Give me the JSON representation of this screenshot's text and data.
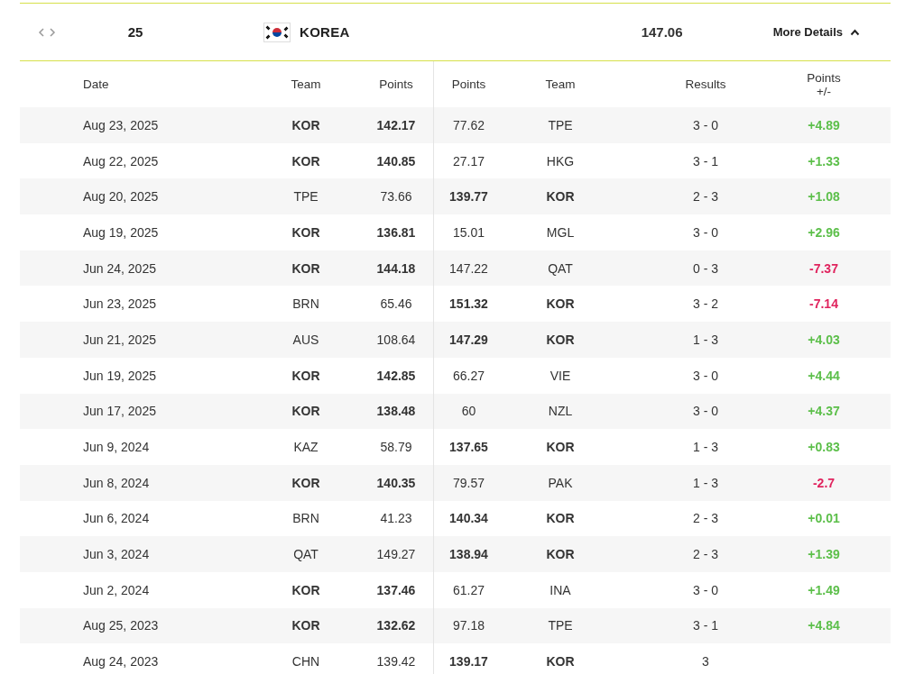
{
  "summary": {
    "rank": "25",
    "country": "KOREA",
    "points": "147.06",
    "toggle": {
      "label": "More Details",
      "expanded": true
    }
  },
  "table": {
    "columns": [
      "Date",
      "Team",
      "Points",
      "Points",
      "Team",
      "Results",
      "Points +/-"
    ],
    "rows": [
      {
        "date": "Aug 23, 2025",
        "left": {
          "team": "KOR",
          "points": "142.17",
          "highlighted": true
        },
        "right": {
          "team": "TPE",
          "points": "77.62",
          "highlighted": false
        },
        "result": "3 - 0",
        "delta": "+4.89",
        "color": "#5cbf4a"
      },
      {
        "date": "Aug 22, 2025",
        "left": {
          "team": "KOR",
          "points": "140.85",
          "highlighted": true
        },
        "right": {
          "team": "HKG",
          "points": "27.17",
          "highlighted": false
        },
        "result": "3 - 1",
        "delta": "+1.33",
        "color": "#5cbf4a"
      },
      {
        "date": "Aug 20, 2025",
        "left": {
          "team": "TPE",
          "points": "73.66",
          "highlighted": false
        },
        "right": {
          "team": "KOR",
          "points": "139.77",
          "highlighted": true
        },
        "result": "2 - 3",
        "delta": "+1.08",
        "color": "#5cbf4a"
      },
      {
        "date": "Aug 19, 2025",
        "left": {
          "team": "KOR",
          "points": "136.81",
          "highlighted": true
        },
        "right": {
          "team": "MGL",
          "points": "15.01",
          "highlighted": false
        },
        "result": "3 - 0",
        "delta": "+2.96",
        "color": "#5cbf4a"
      },
      {
        "date": "Jun 24, 2025",
        "left": {
          "team": "KOR",
          "points": "144.18",
          "highlighted": true
        },
        "right": {
          "team": "QAT",
          "points": "147.22",
          "highlighted": false
        },
        "result": "0 - 3",
        "delta": "-7.37",
        "color": "#e0245e"
      },
      {
        "date": "Jun 23, 2025",
        "left": {
          "team": "BRN",
          "points": "65.46",
          "highlighted": false
        },
        "right": {
          "team": "KOR",
          "points": "151.32",
          "highlighted": true
        },
        "result": "3 - 2",
        "delta": "-7.14",
        "color": "#e0245e"
      },
      {
        "date": "Jun 21, 2025",
        "left": {
          "team": "AUS",
          "points": "108.64",
          "highlighted": false
        },
        "right": {
          "team": "KOR",
          "points": "147.29",
          "highlighted": true
        },
        "result": "1 - 3",
        "delta": "+4.03",
        "color": "#5cbf4a"
      },
      {
        "date": "Jun 19, 2025",
        "left": {
          "team": "KOR",
          "points": "142.85",
          "highlighted": true
        },
        "right": {
          "team": "VIE",
          "points": "66.27",
          "highlighted": false
        },
        "result": "3 - 0",
        "delta": "+4.44",
        "color": "#5cbf4a"
      },
      {
        "date": "Jun 17, 2025",
        "left": {
          "team": "KOR",
          "points": "138.48",
          "highlighted": true
        },
        "right": {
          "team": "NZL",
          "points": "60",
          "highlighted": false
        },
        "result": "3 - 0",
        "delta": "+4.37",
        "color": "#5cbf4a"
      },
      {
        "date": "Jun 9, 2024",
        "left": {
          "team": "KAZ",
          "points": "58.79",
          "highlighted": false
        },
        "right": {
          "team": "KOR",
          "points": "137.65",
          "highlighted": true
        },
        "result": "1 - 3",
        "delta": "+0.83",
        "color": "#5cbf4a"
      },
      {
        "date": "Jun 8, 2024",
        "left": {
          "team": "KOR",
          "points": "140.35",
          "highlighted": true
        },
        "right": {
          "team": "PAK",
          "points": "79.57",
          "highlighted": false
        },
        "result": "1 - 3",
        "delta": "-2.7",
        "color": "#e0245e"
      },
      {
        "date": "Jun 6, 2024",
        "left": {
          "team": "BRN",
          "points": "41.23",
          "highlighted": false
        },
        "right": {
          "team": "KOR",
          "points": "140.34",
          "highlighted": true
        },
        "result": "2 - 3",
        "delta": "+0.01",
        "color": "#5cbf4a"
      },
      {
        "date": "Jun 3, 2024",
        "left": {
          "team": "QAT",
          "points": "149.27",
          "highlighted": false
        },
        "right": {
          "team": "KOR",
          "points": "138.94",
          "highlighted": true
        },
        "result": "2 - 3",
        "delta": "+1.39",
        "color": "#5cbf4a"
      },
      {
        "date": "Jun 2, 2024",
        "left": {
          "team": "KOR",
          "points": "137.46",
          "highlighted": true
        },
        "right": {
          "team": "INA",
          "points": "61.27",
          "highlighted": false
        },
        "result": "3 - 0",
        "delta": "+1.49",
        "color": "#5cbf4a"
      },
      {
        "date": "Aug 25, 2023",
        "left": {
          "team": "KOR",
          "points": "132.62",
          "highlighted": true
        },
        "right": {
          "team": "TPE",
          "points": "97.18",
          "highlighted": false
        },
        "result": "3 - 1",
        "delta": "+4.84",
        "color": "#5cbf4a"
      },
      {
        "date": "Aug 24, 2023",
        "left": {
          "team": "CHN",
          "points": "139.42",
          "highlighted": false
        },
        "right": {
          "team": "KOR",
          "points": "139.17",
          "highlighted": true
        },
        "result": "3"
      }
    ]
  }
}
